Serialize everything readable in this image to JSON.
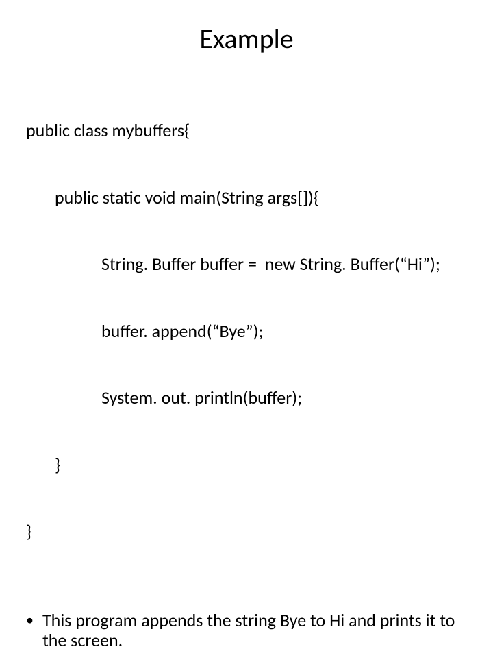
{
  "title": "Example",
  "code": {
    "l1": "public class mybuffers{",
    "l2": "public static void main(String args[]){",
    "l3": "String. Buffer buffer =  new String. Buffer(“Hi”);",
    "l4": "buffer. append(“Bye”);",
    "l5": "System. out. println(buffer);",
    "l6": "}",
    "l7": "}"
  },
  "bullet": "This program appends the string Bye to Hi and prints it to the screen."
}
